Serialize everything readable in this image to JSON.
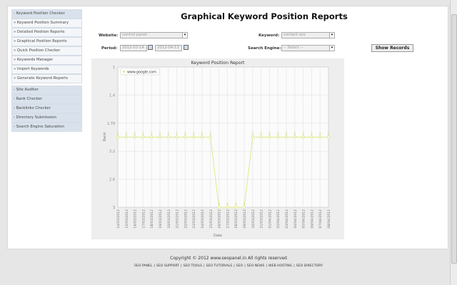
{
  "sidebar": {
    "items": [
      {
        "label": "- Keyword Position Checker",
        "type": "head"
      },
      {
        "label": "» Keyword Position Summary",
        "type": "sub"
      },
      {
        "label": "» Detailed Position Reports",
        "type": "sub"
      },
      {
        "label": "» Graphical Position Reports",
        "type": "sub"
      },
      {
        "label": "» Quick Position Checker",
        "type": "sub"
      },
      {
        "label": "» Keywords Manager",
        "type": "sub"
      },
      {
        "label": "» Import Keywords",
        "type": "sub"
      },
      {
        "label": "» Generate Keyword Reports",
        "type": "sub"
      },
      {
        "label": "- Site Auditor",
        "type": "head"
      },
      {
        "label": "- Rank Checker",
        "type": "head"
      },
      {
        "label": "- Backlinks Checker",
        "type": "head"
      },
      {
        "label": "- Directory Submission",
        "type": "head"
      },
      {
        "label": "- Search Engine Saturation",
        "type": "head"
      }
    ]
  },
  "page": {
    "title": "Graphical Keyword Position Reports"
  },
  "form": {
    "website_label": "Website:",
    "website_value": "control panel",
    "keyword_label": "Keyword:",
    "keyword_value": "contact seo",
    "period_label": "Period:",
    "from_date": "2012-03-14",
    "to_date": "2012-04-13",
    "engine_label": "Search Engine:",
    "engine_value": "-- Select --",
    "show_button": "Show Records"
  },
  "chart_data": {
    "type": "line",
    "title": "Keyword Position Report",
    "xlabel": "Date",
    "ylabel": "Rank",
    "legend": [
      "www.google.com"
    ],
    "legend_position": "top-left",
    "ylim": [
      1,
      3
    ],
    "y_inverted": true,
    "yticks": [
      "1",
      "1.4",
      "1.79",
      "2.2",
      "2.6",
      "3"
    ],
    "categories": [
      "14/03/2012",
      "15/03/2012",
      "16/03/2012",
      "17/03/2012",
      "18/03/2012",
      "19/03/2012",
      "20/03/2012",
      "21/03/2012",
      "22/03/2012",
      "23/03/2012",
      "24/03/2012",
      "25/03/2012",
      "26/03/2012",
      "27/03/2012",
      "28/03/2012",
      "29/03/2012",
      "30/03/2012",
      "31/03/2012",
      "01/04/2012",
      "02/04/2012",
      "03/04/2012",
      "04/04/2012",
      "05/04/2012",
      "06/04/2012",
      "07/04/2012",
      "08/04/2012"
    ],
    "series": [
      {
        "name": "www.google.com",
        "color": "#e0e890",
        "values": [
          2,
          2,
          2,
          2,
          2,
          2,
          2,
          2,
          2,
          2,
          2,
          2,
          3,
          3,
          3,
          3,
          2,
          2,
          2,
          2,
          2,
          2,
          2,
          2,
          2,
          2
        ]
      }
    ]
  },
  "footer": {
    "copyright": "Copyright © 2012 www.seopanel.in All rights reserved",
    "links": [
      "SEO PANEL",
      "SEO SUPPORT",
      "SEO TOOLS",
      "SEO TUTORIALS",
      "SEO",
      "SEO NEWS",
      "WEB HOSTING",
      "SEO DIRECTORY"
    ]
  }
}
